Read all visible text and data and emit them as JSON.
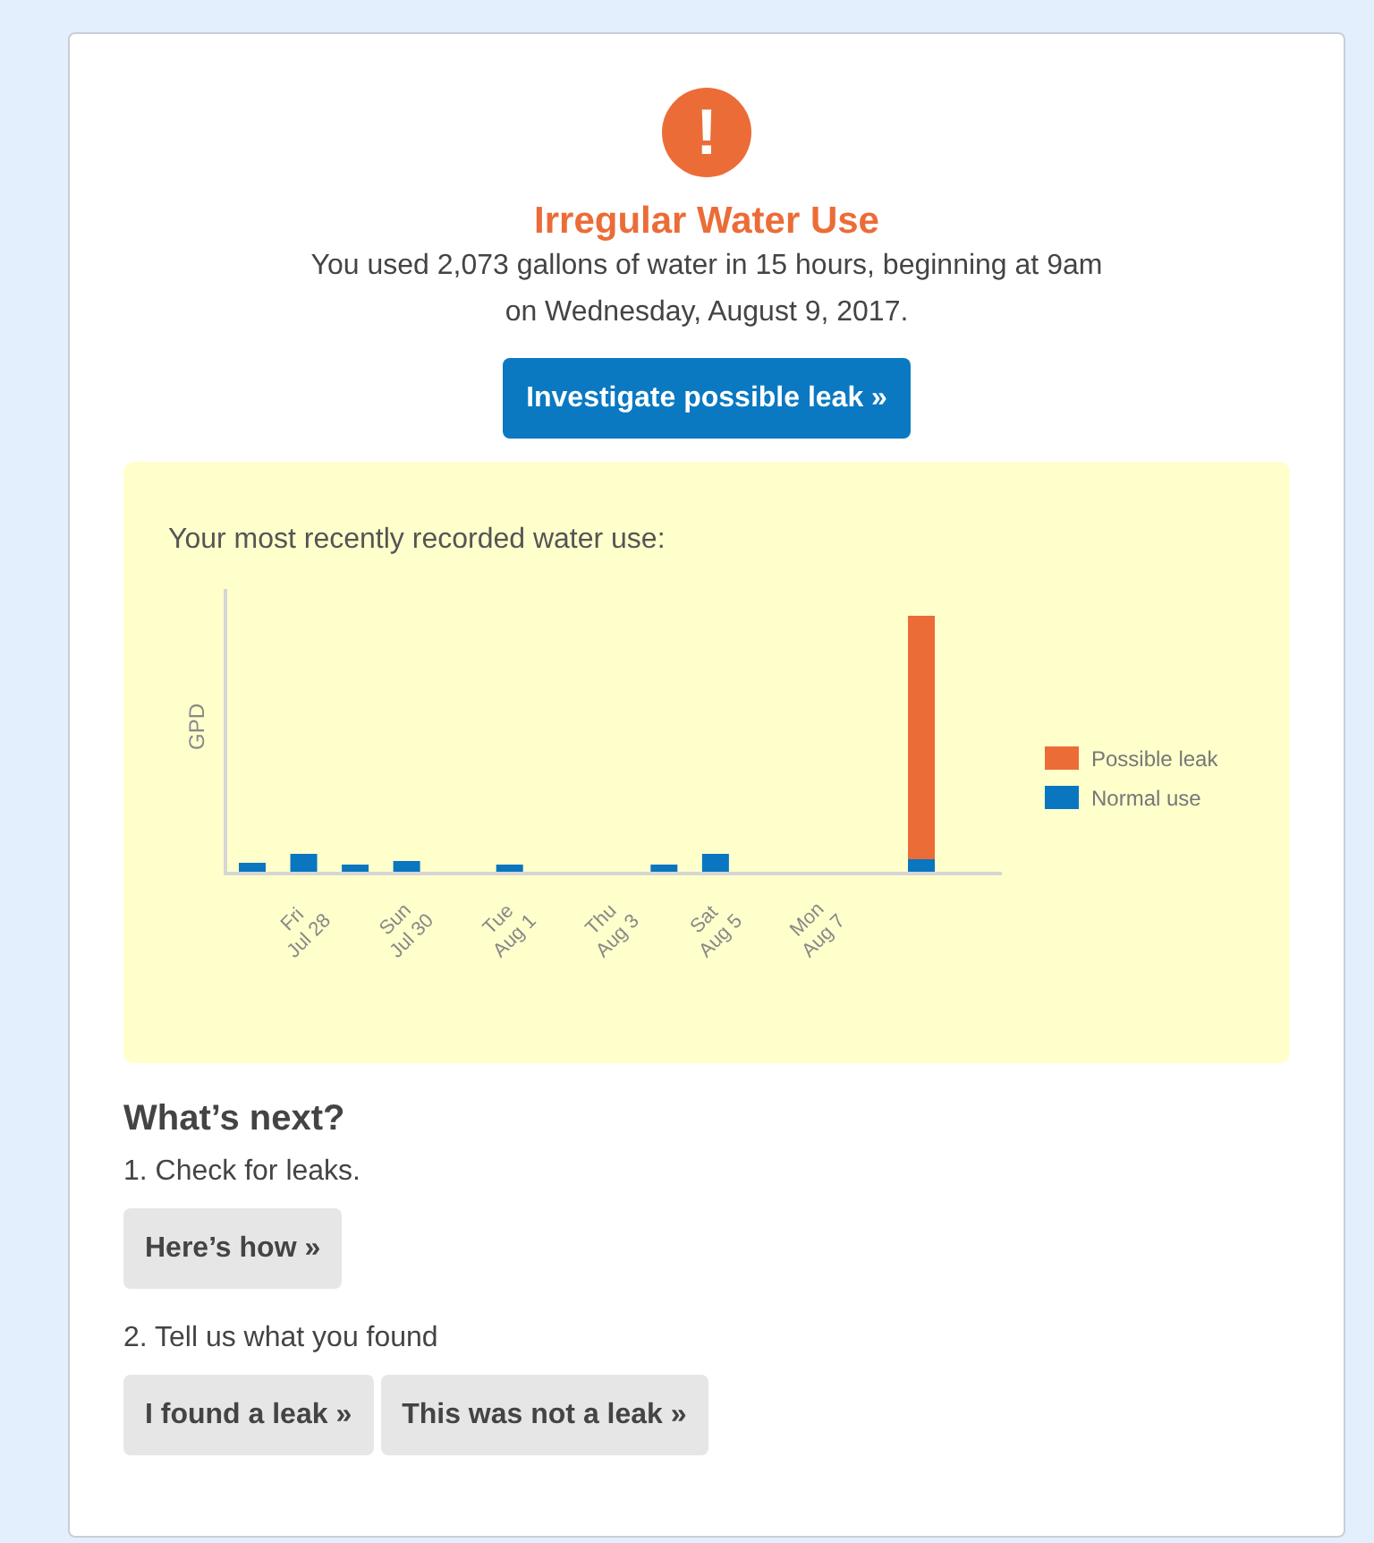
{
  "alert": {
    "icon_glyph": "!",
    "title": "Irregular Water Use",
    "message_lines": [
      "You used 2,073 gallons of water in 15 hours, beginning at 9am",
      "on Wednesday, August 9, 2017."
    ],
    "button": "Investigate possible leak »"
  },
  "usage_panel": {
    "title": "Your most recently recorded water use:",
    "ylabel": "GPD",
    "x_labels": [
      [
        "Fri",
        "Jul 28"
      ],
      [
        "Sun",
        "Jul 30"
      ],
      [
        "Tue",
        "Aug 1"
      ],
      [
        "Thu",
        "Aug 3"
      ],
      [
        "Sat",
        "Aug 5"
      ],
      [
        "Mon",
        "Aug 7"
      ]
    ],
    "legend": [
      {
        "label": "Possible leak",
        "color": "#ec6c37"
      },
      {
        "label": "Normal use",
        "color": "#0a76c0"
      }
    ]
  },
  "next_steps": {
    "heading": "What’s next?",
    "steps": [
      {
        "text": "1. Check for leaks.",
        "buttons": [
          "Here’s how »"
        ]
      },
      {
        "text": "2. Tell us what you found",
        "buttons": [
          "I found a leak »",
          "This was not a leak »"
        ]
      }
    ]
  }
}
